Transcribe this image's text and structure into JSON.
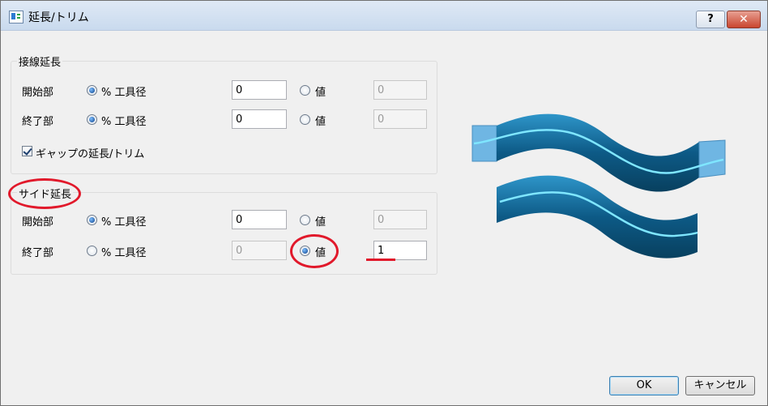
{
  "window": {
    "title": "延長/トリム",
    "help_label": "?",
    "close_label": "✕"
  },
  "tangent_group": {
    "title": "接線延長",
    "start": {
      "label": "開始部",
      "percent_label": "% 工具径",
      "percent_value": "0",
      "value_label": "値",
      "value_value": "0"
    },
    "end": {
      "label": "終了部",
      "percent_label": "% 工具径",
      "percent_value": "0",
      "value_label": "値",
      "value_value": "0"
    },
    "gap_checkbox_label": "ギャップの延長/トリム"
  },
  "side_group": {
    "title": "サイド延長",
    "start": {
      "label": "開始部",
      "percent_label": "% 工具径",
      "percent_value": "0",
      "value_label": "値",
      "value_value": "0"
    },
    "end": {
      "label": "終了部",
      "percent_label": "% 工具径",
      "percent_value": "0",
      "value_label": "値",
      "value_value": "1"
    }
  },
  "footer": {
    "ok_label": "OK",
    "cancel_label": "キャンセル"
  },
  "colors": {
    "annotation": "#e1192b",
    "ribbon": "#0d5a86",
    "ribbon_light": "#2aa5e0",
    "path": "#7fe6ff"
  },
  "icons": [
    "help-icon",
    "close-icon",
    "app-icon",
    "checkmark-icon"
  ]
}
